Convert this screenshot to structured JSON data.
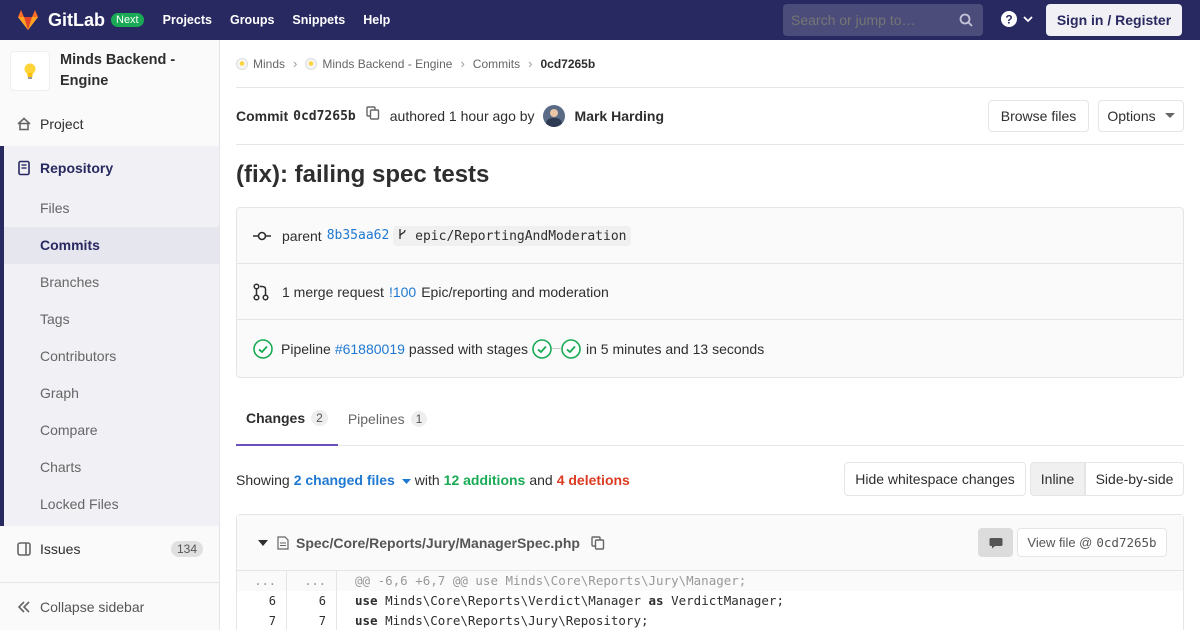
{
  "nav": {
    "brand": "GitLab",
    "badge": "Next",
    "links": [
      "Projects",
      "Groups",
      "Snippets",
      "Help"
    ],
    "search_placeholder": "Search or jump to…",
    "signin": "Sign in / Register"
  },
  "sidebar": {
    "project_name": "Minds Backend - Engine",
    "project": "Project",
    "repository": "Repository",
    "repo_items": [
      "Files",
      "Commits",
      "Branches",
      "Tags",
      "Contributors",
      "Graph",
      "Compare",
      "Charts",
      "Locked Files"
    ],
    "issues": "Issues",
    "issues_count": "134",
    "collapse": "Collapse sidebar"
  },
  "breadcrumbs": [
    "Minds",
    "Minds Backend - Engine",
    "Commits",
    "0cd7265b"
  ],
  "commit": {
    "label": "Commit",
    "sha": "0cd7265b",
    "authored": "authored 1 hour ago by",
    "author": "Mark Harding",
    "browse": "Browse files",
    "options": "Options",
    "title": "(fix): failing spec tests",
    "parent_label": "parent",
    "parent_sha": "8b35aa62",
    "branch": "epic/ReportingAndModeration",
    "mr_text": "1 merge request",
    "mr_link": "!100",
    "mr_title": "Epic/reporting and moderation",
    "pipeline_label": "Pipeline",
    "pipeline_link": "#61880019",
    "pipeline_passed": "passed with stages",
    "pipeline_duration": "in 5 minutes and 13 seconds"
  },
  "tabs": [
    {
      "label": "Changes",
      "count": "2"
    },
    {
      "label": "Pipelines",
      "count": "1"
    }
  ],
  "summary": {
    "showing": "Showing",
    "changed": "2 changed files",
    "with": "with",
    "additions": "12 additions",
    "and": "and",
    "deletions": "4 deletions",
    "hide_ws": "Hide whitespace changes",
    "inline": "Inline",
    "side": "Side-by-side"
  },
  "file": {
    "path": "Spec/Core/Reports/Jury/ManagerSpec.php",
    "view_file": "View file @",
    "view_sha": "0cd7265b",
    "lines": [
      {
        "old": "...",
        "new": "...",
        "code": "@@ -6,6 +6,7 @@ use Minds\\Core\\Reports\\Jury\\Manager;"
      },
      {
        "old": "6",
        "new": "6",
        "kw": "use",
        "code": " Minds\\Core\\Reports\\Verdict\\Manager ",
        "kw2": "as",
        "code2": " VerdictManager;"
      },
      {
        "old": "7",
        "new": "7",
        "kw": "use",
        "code": " Minds\\Core\\Reports\\Jury\\Repository;"
      }
    ]
  },
  "colors": {
    "navbar": "#292961",
    "link": "#1f78d1",
    "success": "#1aaa55",
    "danger": "#db3b21",
    "tab_active": "#6b4fbb"
  }
}
